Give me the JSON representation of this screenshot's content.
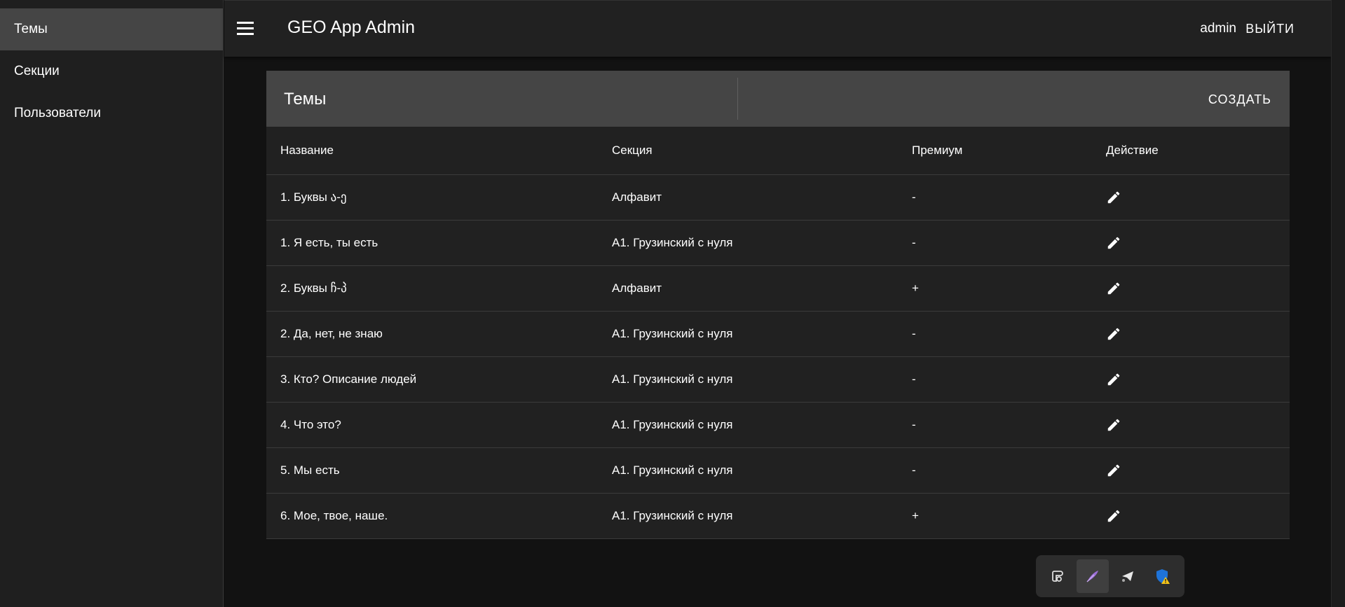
{
  "sidebar": {
    "items": [
      {
        "label": "Темы",
        "active": true
      },
      {
        "label": "Секции",
        "active": false
      },
      {
        "label": "Пользователи",
        "active": false
      }
    ]
  },
  "header": {
    "title": "GEO App Admin",
    "user": "admin",
    "logout_label": "ВЫЙТИ"
  },
  "card": {
    "title": "Темы",
    "create_label": "СОЗДАТЬ"
  },
  "table": {
    "columns": [
      "Название",
      "Секция",
      "Премиум",
      "Действие"
    ],
    "rows": [
      {
        "name": "1. Буквы ა-ე",
        "section": "Алфавит",
        "premium": "-"
      },
      {
        "name": "1. Я есть, ты есть",
        "section": "А1. Грузинский с нуля",
        "premium": "-"
      },
      {
        "name": "2. Буквы ჩ-პ",
        "section": "Алфавит",
        "premium": "+"
      },
      {
        "name": "2. Да, нет, не знаю",
        "section": "А1. Грузинский с нуля",
        "premium": "-"
      },
      {
        "name": "3. Кто? Описание людей",
        "section": "А1. Грузинский с нуля",
        "premium": "-"
      },
      {
        "name": "4. Что это?",
        "section": "А1. Грузинский с нуля",
        "premium": "-"
      },
      {
        "name": "5. Мы есть",
        "section": "А1. Грузинский с нуля",
        "premium": "-"
      },
      {
        "name": "6. Мое, твое, наше.",
        "section": "А1. Грузинский с нуля",
        "premium": "+"
      }
    ],
    "action_icon": "edit-pencil-icon"
  },
  "extensions_toolbar": {
    "icons": [
      "script-extension-icon",
      "feather-extension-icon",
      "telegram-send-icon",
      "shield-warning-icon"
    ]
  },
  "colors": {
    "background": "#121212",
    "sidebar": "#1f1f1f",
    "sidebar_active": "#454545",
    "appbar": "#212121",
    "card_header": "#454545",
    "card_body": "#212121"
  }
}
